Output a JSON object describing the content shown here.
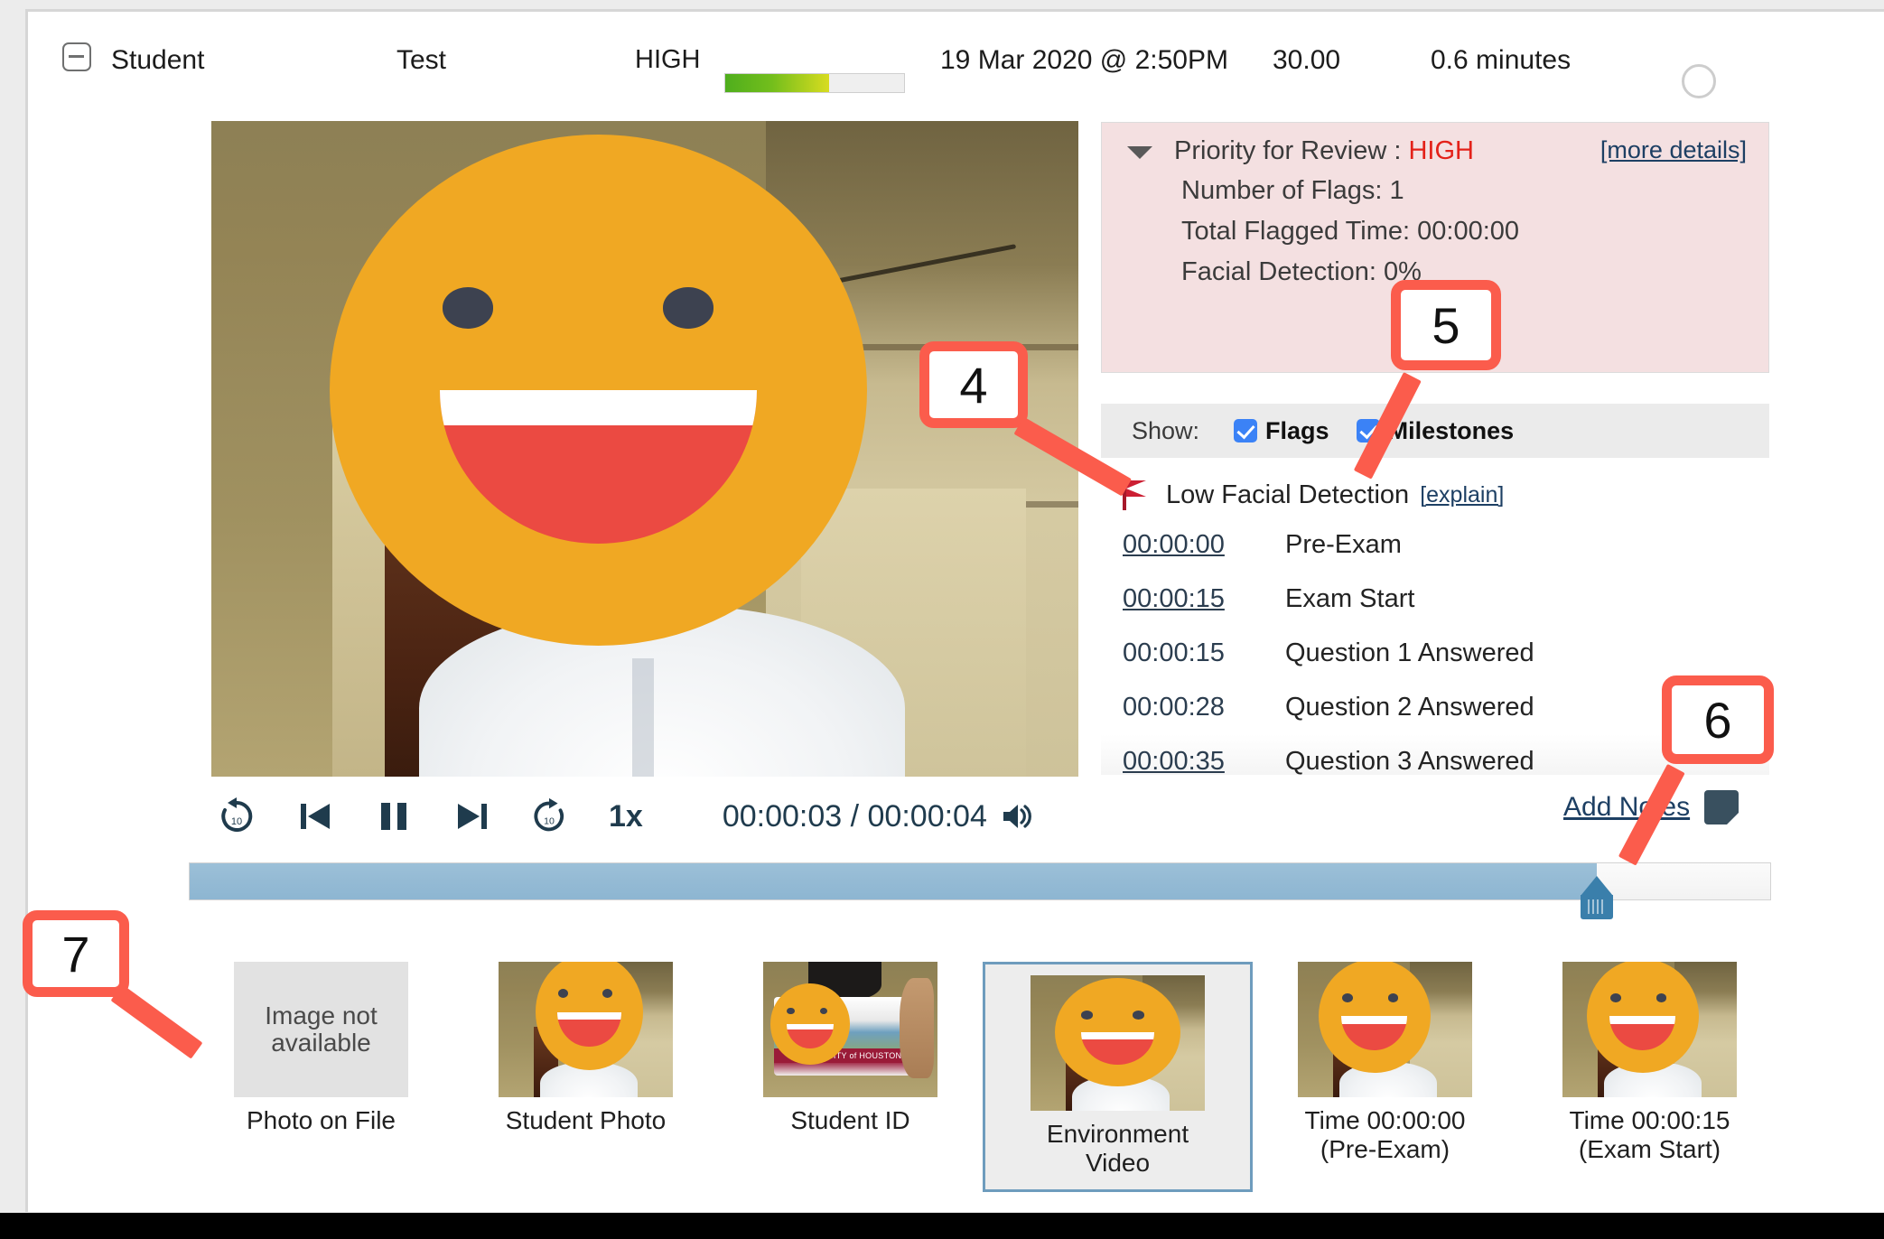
{
  "header": {
    "collapse_icon": "minus-square-icon",
    "student_label": "Student",
    "exam_label": "Test",
    "risk_level": "HIGH",
    "risk_bar_fill_percent": 58,
    "risk_bar_color_start": "#4fae1d",
    "risk_bar_color_end": "#d8dc20",
    "date": "19 Mar 2020 @ 2:50PM",
    "score": "30.00",
    "duration": "0.6 minutes",
    "status_icon": "spinner-circle-icon"
  },
  "priority_panel": {
    "caret_icon": "caret-down-icon",
    "title_prefix": "Priority for Review : ",
    "title_value": "HIGH",
    "title_value_color": "#e32119",
    "more_details_link": "[more details]",
    "flags_line": "Number of Flags: 1",
    "flagged_time_line": "Total Flagged Time: 00:00:00",
    "facial_detection_line": "Facial Detection: 0%",
    "background_color": "#f4e0e1"
  },
  "show_bar": {
    "label": "Show:",
    "flags_label": "Flags",
    "flags_checked": true,
    "milestones_label": "Milestones",
    "milestones_checked": true
  },
  "flag": {
    "icon": "red-flag-icon",
    "text": "Low Facial Detection",
    "explain_link": "[explain]"
  },
  "milestones": [
    {
      "time": "00:00:00",
      "label": "Pre-Exam",
      "link": true,
      "shaded": false
    },
    {
      "time": "00:00:15",
      "label": "Exam Start",
      "link": true,
      "shaded": false
    },
    {
      "time": "00:00:15",
      "label": "Question 1 Answered",
      "link": false,
      "shaded": false
    },
    {
      "time": "00:00:28",
      "label": "Question 2 Answered",
      "link": false,
      "shaded": false
    },
    {
      "time": "00:00:35",
      "label": "Question 3 Answered",
      "link": true,
      "shaded": true
    }
  ],
  "player": {
    "back10_icon": "replay-10-icon",
    "prev_icon": "skip-previous-icon",
    "pause_icon": "pause-icon",
    "next_icon": "skip-next-icon",
    "forward10_icon": "forward-10-icon",
    "speed": "1x",
    "time_display": "00:00:03 / 00:00:04",
    "volume_icon": "volume-on-icon",
    "progress_percent": 89
  },
  "notes": {
    "link_label": "Add Notes",
    "icon": "note-page-icon"
  },
  "thumbnails": [
    {
      "caption": "Photo on File",
      "kind": "placeholder",
      "placeholder_text": "Image\nnot\navailable",
      "selected": false
    },
    {
      "caption": "Student Photo",
      "kind": "face",
      "selected": false
    },
    {
      "caption": "Student ID",
      "kind": "idcard",
      "id_card_text": "UNIVERSITY of HOUSTON",
      "selected": false
    },
    {
      "caption": "Environment\nVideo",
      "kind": "face",
      "selected": true
    },
    {
      "caption": "Time 00:00:00\n(Pre-Exam)",
      "kind": "face",
      "selected": false
    },
    {
      "caption": "Time 00:00:15\n(Exam Start)",
      "kind": "face",
      "selected": false
    }
  ],
  "callouts": [
    {
      "number": "4"
    },
    {
      "number": "5"
    },
    {
      "number": "6"
    },
    {
      "number": "7"
    }
  ],
  "colors": {
    "callout": "#fb5c4c",
    "link": "#1d3f63",
    "scrub_fill": "#94bad4",
    "selected_border": "#6e9cbd"
  }
}
